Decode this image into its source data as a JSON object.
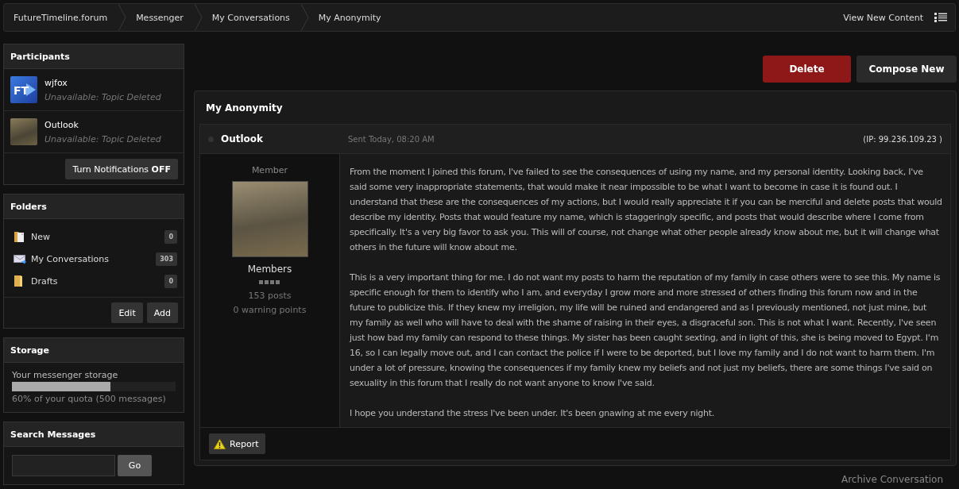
{
  "breadcrumbs": [
    {
      "label": "FutureTimeline.forum"
    },
    {
      "label": "Messenger"
    },
    {
      "label": "My Conversations"
    },
    {
      "label": "My Anonymity"
    }
  ],
  "top_links": {
    "view_new_content": "View New Content"
  },
  "participants": {
    "title": "Participants",
    "items": [
      {
        "name": "wjfox",
        "status": "Unavailable: Topic Deleted",
        "avatar_text": "FT"
      },
      {
        "name": "Outlook",
        "status": "Unavailable: Topic Deleted"
      }
    ],
    "notifications_button": "Turn Notifications **OFF**"
  },
  "folders": {
    "title": "Folders",
    "items": [
      {
        "label": "New",
        "count": "0"
      },
      {
        "label": "My Conversations",
        "count": "303"
      },
      {
        "label": "Drafts",
        "count": "0"
      }
    ],
    "buttons": [
      "Edit",
      "Add"
    ]
  },
  "storage": {
    "title": "Storage",
    "label": "Your messenger storage",
    "level": 0.6,
    "reading": "60% of your quota (500 messages)"
  },
  "search": {
    "title": "Search Messages",
    "button": "Go"
  },
  "actions": {
    "delete": "Delete",
    "compose": "Compose New"
  },
  "conversation": {
    "title": "My Anonymity",
    "message": {
      "author": "Outlook",
      "sent": "Sent Today, 08:20 AM",
      "ip": "(IP: 99.236.109.23 )",
      "author_title": "Member",
      "group": "Members",
      "posts": "153 posts",
      "warnings": "0 warning points",
      "paragraphs": [
        "From the moment I joined this forum, I've failed to see the consequences of using my name, and my personal identity. Looking back, I've said some very inappropriate statements, that would make it near impossible to be what I want to become in case it is found out. I understand that these are the consequences of my actions, but I would really appreciate it if you can be merciful and delete posts that would describe my identity. Posts that would feature my name, which is staggeringly specific, and posts that would describe where I come from specifically. It's a very big favor to ask you. This will of course, not change what other people already know about me, but it will change what others in the future will know about me.",
        "This is a very important thing for me. I do not want my posts to harm the reputation of my family in case others were to see this. My name is specific enough for them to identify who I am, and everyday I grow more and more stressed of others finding this forum now and in the future to publicize this. If they knew my irreligion, my life will be ruined and endangered and as I previously mentioned, not just mine, but my family as well who will have to deal with the shame of raising in their eyes, a disgraceful son. This is not what I want. Recently, I've seen just how bad my family can respond to these things. My sister has been caught sexting, and in light of this, she is being moved to Egypt. I'm 16, so I can legally move out, and I can contact the police if I were to be deported, but I love my family and I do not want to harm them. I'm under a lot of pressure, knowing the consequences if my family knew my beliefs and not just my beliefs, there are some things I've said on sexuality in this forum that I really do not want anyone to know I've said.",
        "I hope you understand the stress I've been under. It's been gnawing at me every night."
      ],
      "report": "Report"
    }
  },
  "archive_link": "Archive Conversation"
}
